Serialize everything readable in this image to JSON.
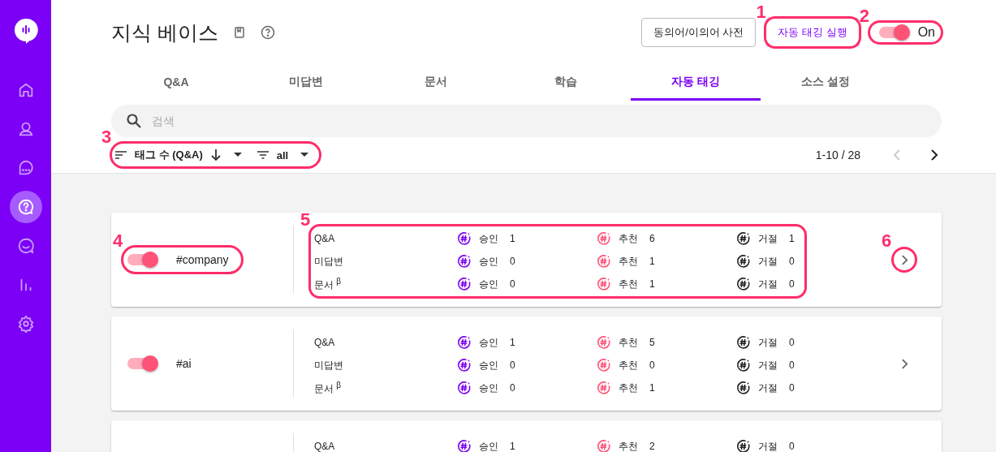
{
  "sidebar": {
    "items": [
      {
        "kind": "home",
        "selected": false
      },
      {
        "kind": "user",
        "selected": false
      },
      {
        "kind": "chat",
        "selected": false
      },
      {
        "kind": "question",
        "selected": true
      },
      {
        "kind": "smile",
        "selected": false
      },
      {
        "kind": "stats",
        "selected": false
      },
      {
        "kind": "settings",
        "selected": false
      }
    ]
  },
  "header": {
    "title": "지식 베이스",
    "buttons": [
      {
        "label": "동의어/이의어 사전",
        "kind": "outline"
      },
      {
        "label": "자동 태깅 실행",
        "kind": "primary",
        "callout": "1"
      }
    ],
    "auto_toggle": {
      "label": "On",
      "on": true,
      "callout": "2"
    }
  },
  "tabs": [
    {
      "label": "Q&A",
      "selected": false
    },
    {
      "label": "미답변",
      "selected": false
    },
    {
      "label": "문서",
      "selected": false
    },
    {
      "label": "학습",
      "selected": false
    },
    {
      "label": "자동 태깅",
      "selected": true
    },
    {
      "label": "소스 설정",
      "selected": false
    }
  ],
  "search": {
    "placeholder": "검색"
  },
  "toolbar": {
    "sort": {
      "label": "태그 수 (Q&A)"
    },
    "filter": {
      "label": "all"
    },
    "callout": "3",
    "pagination": {
      "range": "1-10 / 28",
      "prev_disabled": true
    }
  },
  "tags": [
    {
      "name": "#company",
      "on": true,
      "toggle_callout": "4",
      "stats_callout": "5",
      "open_callout": "6",
      "rows": [
        {
          "source": "Q&A",
          "stats": [
            {
              "kind": "approved",
              "label": "승인",
              "value": "1"
            },
            {
              "kind": "recommended",
              "label": "추천",
              "value": "6"
            },
            {
              "kind": "rejected",
              "label": "거절",
              "value": "1"
            }
          ]
        },
        {
          "source": "미답변",
          "stats": [
            {
              "kind": "approved",
              "label": "승인",
              "value": "0"
            },
            {
              "kind": "recommended",
              "label": "추천",
              "value": "1"
            },
            {
              "kind": "rejected",
              "label": "거절",
              "value": "0"
            }
          ]
        },
        {
          "source": "문서 $^{β}$",
          "stats": [
            {
              "kind": "approved",
              "label": "승인",
              "value": "0"
            },
            {
              "kind": "recommended",
              "label": "추천",
              "value": "1"
            },
            {
              "kind": "rejected",
              "label": "거절",
              "value": "0"
            }
          ]
        }
      ]
    },
    {
      "name": "#ai",
      "on": true,
      "rows": [
        {
          "source": "Q&A",
          "stats": [
            {
              "kind": "approved",
              "label": "승인",
              "value": "1"
            },
            {
              "kind": "recommended",
              "label": "추천",
              "value": "5"
            },
            {
              "kind": "rejected",
              "label": "거절",
              "value": "0"
            }
          ]
        },
        {
          "source": "미답변",
          "stats": [
            {
              "kind": "approved",
              "label": "승인",
              "value": "0"
            },
            {
              "kind": "recommended",
              "label": "추천",
              "value": "0"
            },
            {
              "kind": "rejected",
              "label": "거절",
              "value": "0"
            }
          ]
        },
        {
          "source": "문서 $^{β}$",
          "stats": [
            {
              "kind": "approved",
              "label": "승인",
              "value": "0"
            },
            {
              "kind": "recommended",
              "label": "추천",
              "value": "1"
            },
            {
              "kind": "rejected",
              "label": "거절",
              "value": "0"
            }
          ]
        }
      ]
    },
    {
      "rows": [
        {
          "source": "Q&A",
          "stats": [
            {
              "kind": "approved",
              "label": "승인",
              "value": "1"
            },
            {
              "kind": "recommended",
              "label": "추천",
              "value": "2"
            },
            {
              "kind": "rejected",
              "label": "거절",
              "value": "0"
            }
          ]
        }
      ]
    }
  ]
}
